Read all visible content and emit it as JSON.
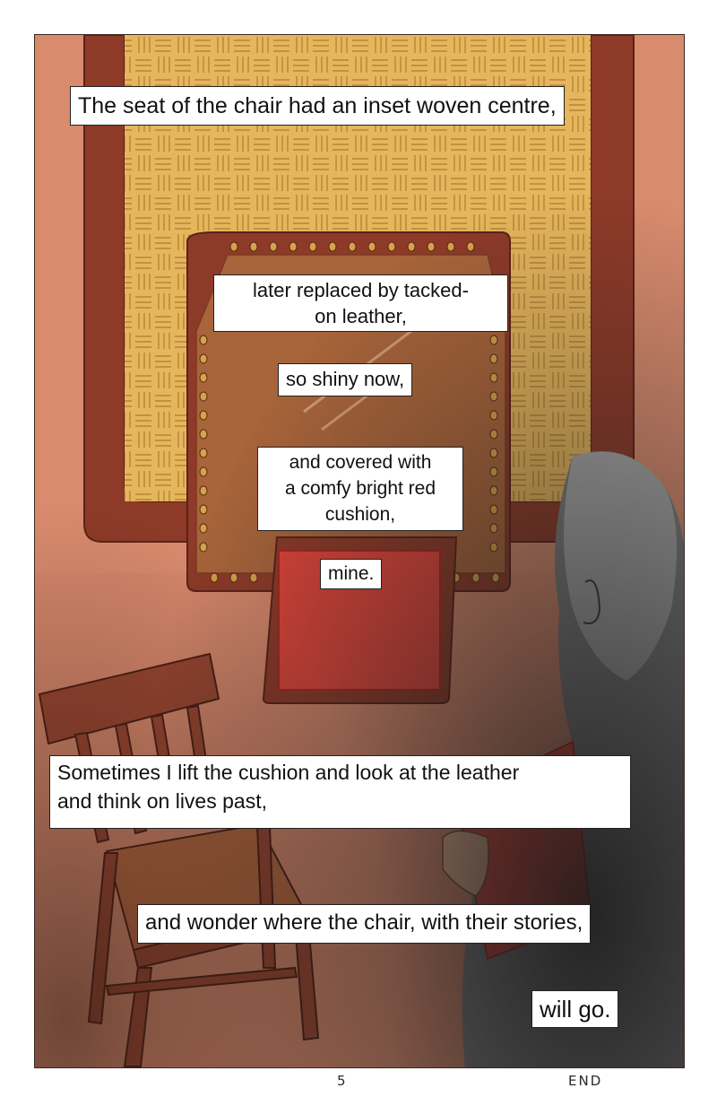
{
  "panel": {
    "captions": [
      "The seat of the chair had an inset woven centre,",
      "later replaced by tacked-\non leather,",
      "so shiny now,",
      "and covered with\na comfy bright red\ncushion,",
      "mine.",
      "Sometimes I lift the cushion and look at the leather\nand think on lives past,",
      "and wonder where the chair, with their stories,",
      "will go."
    ]
  },
  "footer": {
    "page_number": "5",
    "end_label": "END"
  },
  "colors": {
    "background_wall": "#d98b6e",
    "wicker": "#e3b25a",
    "chair_wood": "#8e3a28",
    "leather": "#a8643a",
    "cushion": "#e0453a",
    "person": "#8a8a8a"
  }
}
